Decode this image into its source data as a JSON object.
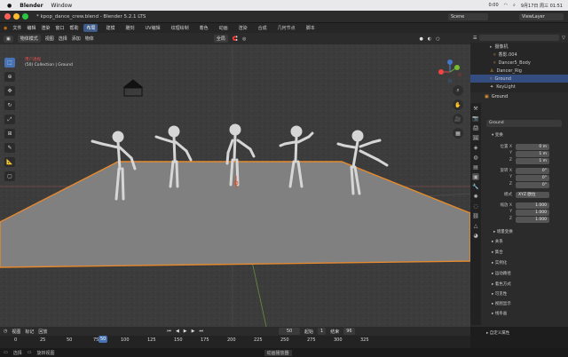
{
  "macbar": {
    "app": "Blender",
    "menu": "Window",
    "clock": "9月17日 周三 01:51",
    "battery": "0:00"
  },
  "window": {
    "title": "* kpop_dance_crew.blend - Blender 5.2.1 LTS",
    "scene": "Scene",
    "viewlayer": "ViewLayer"
  },
  "menus": [
    "文件",
    "编辑",
    "渲染",
    "窗口",
    "帮助"
  ],
  "workspaces": [
    "布局",
    "建模",
    "雕刻",
    "UV编辑",
    "纹理绘制",
    "着色",
    "动画",
    "渲染",
    "合成",
    "几何节点",
    "脚本"
  ],
  "active_workspace": "布局",
  "viewport_header": {
    "mode": "物体模式",
    "items": [
      "视图",
      "选择",
      "添加",
      "物体"
    ],
    "transform": "全局"
  },
  "viewport": {
    "view_name": "用户透视",
    "collection": "(50) Collection | Ground"
  },
  "outliner": {
    "rows": [
      {
        "name": "摄像机",
        "indent": 2
      },
      {
        "name": "香影.004",
        "indent": 3
      },
      {
        "name": "Dancer5_Body",
        "indent": 3
      },
      {
        "name": "Dancer_Rig",
        "indent": 2
      },
      {
        "name": "Ground",
        "indent": 2,
        "selected": true
      },
      {
        "name": "KeyLight",
        "indent": 2
      }
    ]
  },
  "properties": {
    "object_name": "Ground",
    "datablock": "Ground",
    "transform_header": "变换",
    "location_label": "位置 X",
    "location": {
      "x": "0 m",
      "y": "1 m",
      "z": "1 m"
    },
    "rotation_label": "旋转 X",
    "rotation": {
      "x": "0°",
      "y": "0°",
      "z": "0°"
    },
    "mode_label": "模式",
    "mode_value": "XYZ 欧拉",
    "scale_label": "缩放 X",
    "scale": {
      "x": "1.000",
      "y": "1.000",
      "z": "1.000"
    },
    "axis": {
      "y": "Y",
      "z": "Z"
    },
    "sections": [
      "增量变换",
      "关系",
      "集合",
      "实例化",
      "运动路径",
      "着色方式",
      "可见性",
      "视图显示",
      "线条画",
      "自定义属性"
    ]
  },
  "timeline": {
    "current": "50",
    "start_label": "起始",
    "start": "1",
    "end_label": "结束",
    "end": "96",
    "menus": [
      "视图",
      "标记",
      "回放"
    ],
    "ticks": [
      "0",
      "25",
      "50",
      "75",
      "100",
      "125",
      "150",
      "175",
      "200",
      "225",
      "250",
      "275",
      "300",
      "325"
    ]
  },
  "status": {
    "left": "选择",
    "mid": "旋转视图",
    "right": "动画播放器"
  }
}
